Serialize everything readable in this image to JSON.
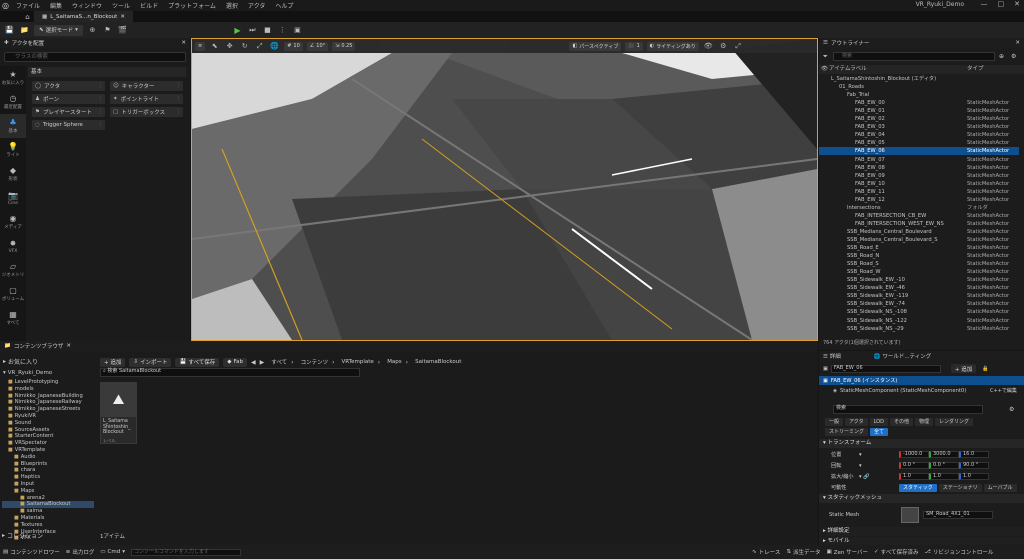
{
  "menu": {
    "items": [
      "ファイル",
      "編集",
      "ウィンドウ",
      "ツール",
      "ビルド",
      "プラットフォーム",
      "選択",
      "アクタ",
      "ヘルプ"
    ],
    "project": "VR_Ryuki_Demo"
  },
  "level_tab": "L_SaitamaS...n_Blockout",
  "toolbar": {
    "mode": "選択モード"
  },
  "place_actors": {
    "title": "アクタを配置",
    "search_placeholder": "クラスの検索",
    "basic": "基本",
    "actors": [
      "アクタ",
      "ポーン",
      "プレイヤースタート",
      "Trigger Sphere",
      "キャラクター",
      "ポイントライト",
      "トリガーボックス"
    ],
    "sidebar": [
      "お気に入り",
      "最近配置",
      "基本",
      "ライト",
      "形状",
      "Cine",
      "メディア",
      "VFX",
      "ジオメトリ",
      "ボリューム",
      "すべて"
    ]
  },
  "viewport": {
    "perspective": "パースペクティブ",
    "lighting": "ライティングあり",
    "snap_grid": "10",
    "snap_angle": "10°",
    "snap_scale": "0.25",
    "speed": "1"
  },
  "outliner": {
    "title": "アウトライナー",
    "search_placeholder": "検索",
    "col_label": "アイテムラベル",
    "col_type": "タイプ",
    "rows": [
      {
        "name": "L_SaitamaShintoshin_Blockout (エディタ)",
        "type": "",
        "indent": 0
      },
      {
        "name": "01_Roads",
        "type": "",
        "indent": 1
      },
      {
        "name": "Fab_Trial",
        "type": "",
        "indent": 2
      },
      {
        "name": "FAB_EW_00",
        "type": "StaticMeshActor",
        "indent": 3
      },
      {
        "name": "FAB_EW_01",
        "type": "StaticMeshActor",
        "indent": 3
      },
      {
        "name": "FAB_EW_02",
        "type": "StaticMeshActor",
        "indent": 3
      },
      {
        "name": "FAB_EW_03",
        "type": "StaticMeshActor",
        "indent": 3
      },
      {
        "name": "FAB_EW_04",
        "type": "StaticMeshActor",
        "indent": 3
      },
      {
        "name": "FAB_EW_05",
        "type": "StaticMeshActor",
        "indent": 3
      },
      {
        "name": "FAB_EW_06",
        "type": "StaticMeshActor",
        "indent": 3,
        "selected": true
      },
      {
        "name": "FAB_EW_07",
        "type": "StaticMeshActor",
        "indent": 3
      },
      {
        "name": "FAB_EW_08",
        "type": "StaticMeshActor",
        "indent": 3
      },
      {
        "name": "FAB_EW_09",
        "type": "StaticMeshActor",
        "indent": 3
      },
      {
        "name": "FAB_EW_10",
        "type": "StaticMeshActor",
        "indent": 3
      },
      {
        "name": "FAB_EW_11",
        "type": "StaticMeshActor",
        "indent": 3
      },
      {
        "name": "FAB_EW_12",
        "type": "StaticMeshActor",
        "indent": 3
      },
      {
        "name": "Intersections",
        "type": "フォルダ",
        "indent": 2
      },
      {
        "name": "FAB_INTERSECTION_CB_EW",
        "type": "StaticMeshActor",
        "indent": 3
      },
      {
        "name": "FAB_INTERSECTION_WEST_EW_NS",
        "type": "StaticMeshActor",
        "indent": 3
      },
      {
        "name": "SSB_Medians_Central_Boulevard",
        "type": "StaticMeshActor",
        "indent": 2
      },
      {
        "name": "SSB_Medians_Central_Boulevard_S",
        "type": "StaticMeshActor",
        "indent": 2
      },
      {
        "name": "SSB_Road_E",
        "type": "StaticMeshActor",
        "indent": 2
      },
      {
        "name": "SSB_Road_N",
        "type": "StaticMeshActor",
        "indent": 2
      },
      {
        "name": "SSB_Road_S",
        "type": "StaticMeshActor",
        "indent": 2
      },
      {
        "name": "SSB_Road_W",
        "type": "StaticMeshActor",
        "indent": 2
      },
      {
        "name": "SSB_Sidewalk_EW_-10",
        "type": "StaticMeshActor",
        "indent": 2
      },
      {
        "name": "SSB_Sidewalk_EW_-46",
        "type": "StaticMeshActor",
        "indent": 2
      },
      {
        "name": "SSB_Sidewalk_EW_-119",
        "type": "StaticMeshActor",
        "indent": 2
      },
      {
        "name": "SSB_Sidewalk_EW_-74",
        "type": "StaticMeshActor",
        "indent": 2
      },
      {
        "name": "SSB_Sidewalk_NS_-108",
        "type": "StaticMeshActor",
        "indent": 2
      },
      {
        "name": "SSB_Sidewalk_NS_-122",
        "type": "StaticMeshActor",
        "indent": 2
      },
      {
        "name": "SSB_Sidewalk_NS_-29",
        "type": "StaticMeshActor",
        "indent": 2
      }
    ],
    "footer": "764 アクタ(1個選択されています)"
  },
  "details": {
    "title": "詳細",
    "world_tab": "ワールド...ティング",
    "actor": "FAB_EW_06",
    "add": "+ 追加",
    "instance": "FAB_EW_06 (インスタンス)",
    "component": "StaticMeshComponent (StaticMeshComponent0)",
    "cpp": "C++で編集",
    "search_placeholder": "検索",
    "tabs": [
      "一般",
      "アクタ",
      "LOD",
      "その他",
      "物理",
      "レンダリング",
      "ストリーミング",
      "全て"
    ],
    "transform": "トランスフォーム",
    "location": {
      "label": "位置",
      "x": "-1000.0",
      "y": "3000.0",
      "z": "16.0"
    },
    "rotation": {
      "label": "回転",
      "x": "0.0 °",
      "y": "0.0 °",
      "z": "90.0 °"
    },
    "scale": {
      "label": "拡大/縮小",
      "x": "1.0",
      "y": "1.0",
      "z": "1.0"
    },
    "mobility": {
      "label": "可動性",
      "options": [
        "スタティック",
        "ステーショナリ",
        "ムーバブル"
      ]
    },
    "static_mesh_section": "スタティックメッシュ",
    "static_mesh_label": "Static Mesh",
    "static_mesh_value": "SM_Road_4X1_01",
    "detail_settings": "詳細設定",
    "mobile": "モバイル"
  },
  "content_browser": {
    "title": "コンテンツブラウザ",
    "favorites": "お気に入り",
    "root": "VR_Ryuki_Demo",
    "add": "+ 追加",
    "import": "インポート",
    "save_all": "すべて保存",
    "fab": "Fab",
    "crumbs": [
      "すべて",
      "コンテンツ",
      "VRTemplate",
      "Maps",
      "SaitamaBlockout"
    ],
    "search_placeholder": "検索 SaitamaBlockout",
    "tree": [
      "LevelPrototyping",
      "models",
      "Nimikko_JapaneseBuilding",
      "Nimikko_JapaneseRailway",
      "Nimikko_JapaneseStreets",
      "RyukiVR",
      "Sound",
      "SourceAssets",
      "StarterContent",
      "VRSpectator",
      "VRTemplate",
      "Audio",
      "Blueprints",
      "chara",
      "Haptics",
      "Input",
      "Maps",
      "arena2",
      "SaitamaBlockout",
      "saima",
      "Materials",
      "Textures",
      "UserInterface",
      "VFX"
    ],
    "collection": "コレクション",
    "asset_name": "L_Saitama Shintoshin_ Blockout",
    "asset_type": "レベル",
    "count": "1アイテム"
  },
  "statusbar": {
    "drawer": "コンテンツドロワー",
    "log": "出力ログ",
    "cmd": "Cmd",
    "cmd_placeholder": "コンソールコマンドを入力します",
    "trace": "トレース",
    "derived": "派生データ",
    "zen": "Zen サーバー",
    "unsaved": "すべて保存済み",
    "revision": "リビジョンコントロール"
  }
}
